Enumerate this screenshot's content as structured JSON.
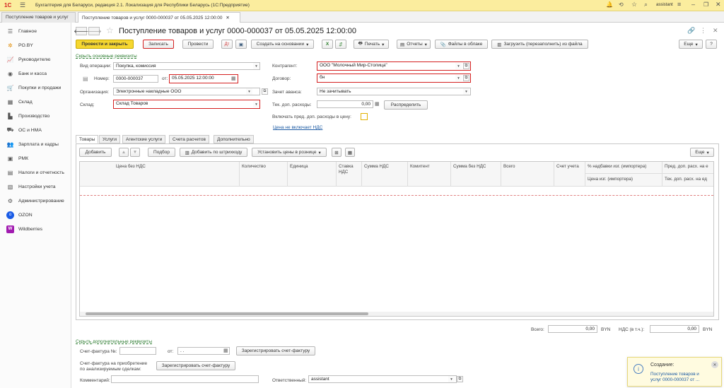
{
  "window": {
    "logo": "1С",
    "title": "Бухгалтерия для Беларуси, редакция 2.1. Локализация для Республики Беларусь  (1С:Предприятие)",
    "user": "assistant"
  },
  "tabs": [
    {
      "label": "Поступление товаров и услуг"
    },
    {
      "label": "Поступление товаров и услуг 0000-000037 от 05.05.2025 12:00:00"
    }
  ],
  "sidebar": {
    "items": [
      {
        "label": "Главное",
        "icon": "menu-icon"
      },
      {
        "label": "PO.BY",
        "icon": "po-icon"
      },
      {
        "label": "Руководителю",
        "icon": "chart-icon"
      },
      {
        "label": "Банк и касса",
        "icon": "bank-icon"
      },
      {
        "label": "Покупки и продажи",
        "icon": "cart-icon"
      },
      {
        "label": "Склад",
        "icon": "warehouse-icon"
      },
      {
        "label": "Производство",
        "icon": "factory-icon"
      },
      {
        "label": "ОС и НМА",
        "icon": "truck-icon"
      },
      {
        "label": "Зарплата и кадры",
        "icon": "people-icon"
      },
      {
        "label": "РМК",
        "icon": "register-icon"
      },
      {
        "label": "Налоги и отчетность",
        "icon": "tax-icon"
      },
      {
        "label": "Настройки учета",
        "icon": "settings-doc-icon"
      },
      {
        "label": "Администрирование",
        "icon": "gear-icon"
      },
      {
        "label": "OZON",
        "icon": "ozon-icon"
      },
      {
        "label": "Wildberries",
        "icon": "wb-icon"
      }
    ]
  },
  "doc": {
    "title": "Поступление товаров и услуг 0000-000037 от 05.05.2025 12:00:00"
  },
  "toolbar": {
    "post_close": "Провести и закрыть",
    "save": "Записать",
    "post": "Провести",
    "create_based": "Создать на основании",
    "print": "Печать",
    "reports": "Отчеты",
    "files_cloud": "Файлы в облаке",
    "load_file": "Загрузить (перезаполнить) из файла",
    "more": "Еще",
    "help": "?"
  },
  "form": {
    "hide_main": "Скрыть основные реквизиты",
    "op_type_label": "Вид операции:",
    "op_type": "Покупка, комиссия",
    "number_label": "Номер:",
    "number": "0000-000037",
    "from_label": "от:",
    "date": "05.05.2025 12:00:00",
    "org_label": "Организация:",
    "org": "Электронные накладные ООО",
    "warehouse_label": "Склад:",
    "warehouse": "Склад Товаров",
    "counterparty_label": "Контрагент:",
    "counterparty": "ООО \"Молочный Мир-Столица\"",
    "contract_label": "Договор:",
    "contract": "бн",
    "advance_label": "Зачет аванса:",
    "advance": "Не зачитывать",
    "extra_label": "Тек. доп. расходы:",
    "extra": "0,00",
    "distribute": "Распределить",
    "include_label": "Включать пред. доп. расходы в цену:",
    "vat_link": "Цена не включает НДС"
  },
  "form_tabs": [
    "Товары",
    "Услуги",
    "Агентские услуги",
    "Счета расчетов",
    "Дополнительно"
  ],
  "table_toolbar": {
    "add": "Добавить",
    "select": "Подбор",
    "barcode": "Добавить по штрихкоду",
    "set_prices": "Установить цены в рознице",
    "more": "Еще"
  },
  "table": {
    "headers": [
      "Цена без НДС",
      "Количество",
      "Единица",
      "Ставка НДС",
      "Сумма НДС",
      "Комитент",
      "Сумма без НДС",
      "Всего",
      "Счет учета",
      "% надбавки изг. (импортера)",
      "Пред. доп. расх. на е"
    ],
    "subheaders": [
      "Цена изг. (импортера)",
      "Тек. доп. расх. на ед"
    ]
  },
  "totals": {
    "total_label": "Всего:",
    "total": "0,00",
    "vat_label": "НДС (в т.ч.):",
    "vat": "0,00",
    "currency": "BYN"
  },
  "footer": {
    "hide_extra": "Скрыть дополнительные реквизиты",
    "invoice_label": "Счет-фактура №:",
    "invoice_from": "от:",
    "invoice_date": " .  .",
    "register_invoice": "Зарегистрировать счет-фактуру",
    "analyzed_label": "Счет-фактура на приобретение по анализируемым сделкам:",
    "register_invoice2": "Зарегистрировать счет-фактуру",
    "comment_label": "Комментарий:",
    "responsible_label": "Ответственный:",
    "responsible": "assistant"
  },
  "notification": {
    "title": "Создание:",
    "text": "Поступление товаров и услуг 0000-000037 от ..."
  },
  "colors": {
    "accent_yellow": "#f6d72f",
    "topbar": "#fbed9e",
    "error_red": "#d42020",
    "link_blue": "#1b5aa3",
    "link_green": "#2e7d32"
  }
}
